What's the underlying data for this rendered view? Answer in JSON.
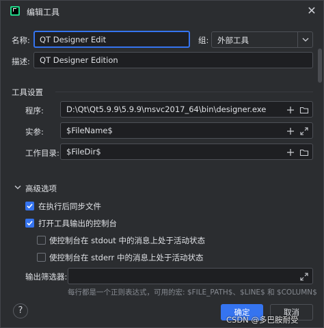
{
  "window": {
    "title": "编辑工具",
    "close_glyph": "✕"
  },
  "form": {
    "name_label": "名称:",
    "name_value": "QT Designer Edit",
    "group_label": "组:",
    "group_value": "外部工具",
    "desc_label": "描述:",
    "desc_value": "QT Designer Edition"
  },
  "tool_settings": {
    "title": "工具设置",
    "program_label": "程序:",
    "program_value": "D:\\Qt\\Qt5.9.9\\5.9.9\\msvc2017_64\\bin\\designer.exe",
    "args_label": "实参:",
    "args_value": "$FileName$",
    "workdir_label": "工作目录:",
    "workdir_value": "$FileDir$"
  },
  "advanced": {
    "title": "高级选项",
    "sync_label": "在执行后同步文件",
    "sync_checked": true,
    "console_label": "打开工具输出的控制台",
    "console_checked": true,
    "stdout_label": "使控制台在 stdout 中的消息上处于活动状态",
    "stdout_checked": false,
    "stderr_label": "使控制台在 stderr 中的消息上处于活动状态",
    "stderr_checked": false,
    "filter_label": "输出筛选器:",
    "filter_value": "",
    "hint": "每行都是一个正则表达式，可用的宏: $FILE_PATH$、$LINE$ 和 $COLUMN$"
  },
  "footer": {
    "help_glyph": "?",
    "ok_label": "确定",
    "cancel_label": "取消"
  },
  "watermark": "CSDN @多巴胺耐受",
  "colors": {
    "accent": "#3574f0",
    "background": "#2b2d30",
    "field_background": "#1e1f22"
  }
}
